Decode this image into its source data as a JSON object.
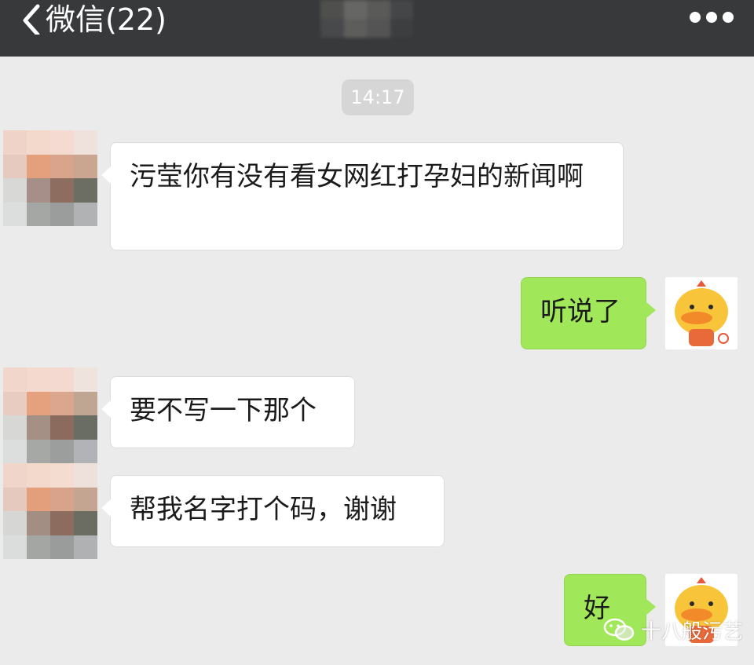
{
  "header": {
    "back_label": "微信(22)",
    "back_icon": "chevron-left-icon",
    "more_icon": "more-dots-icon",
    "contact_name_obscured": true
  },
  "chat": {
    "timestamp": "14:17",
    "messages": [
      {
        "side": "in",
        "text": "污莹你有没有看女网红打孕妇的新闻啊"
      },
      {
        "side": "out",
        "text": "听说了"
      },
      {
        "side": "in",
        "text": "要不写一下那个"
      },
      {
        "side": "in",
        "text": "帮我名字打个码，谢谢"
      },
      {
        "side": "out",
        "text": "好"
      }
    ]
  },
  "watermark": {
    "text": "十八般污艺",
    "icon": "wechat-logo-icon"
  },
  "colors": {
    "topbar": "#38393b",
    "background": "#ebebeb",
    "incoming_bubble": "#ffffff",
    "outgoing_bubble": "#a0e75a",
    "timestamp_pill": "#d6d6d6"
  }
}
